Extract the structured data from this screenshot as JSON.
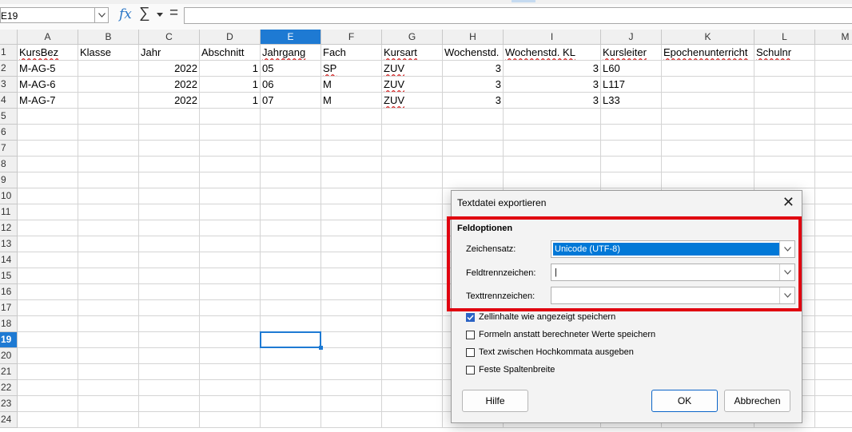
{
  "formula_bar": {
    "name_box": "E19",
    "fx_label": "fx",
    "sigma_label": "∑",
    "equals_label": "=",
    "formula": ""
  },
  "sheet": {
    "columns": [
      "A",
      "B",
      "C",
      "D",
      "E",
      "F",
      "G",
      "H",
      "I",
      "J",
      "K",
      "L",
      "M"
    ],
    "selected_column": "E",
    "rows": [
      "1",
      "2",
      "3",
      "4",
      "5",
      "6",
      "7",
      "8",
      "9",
      "10",
      "11",
      "12",
      "13",
      "14",
      "15",
      "16",
      "17",
      "18",
      "19",
      "20",
      "21",
      "22",
      "23",
      "24"
    ],
    "selected_row": "19",
    "header": [
      "KursBez",
      "Klasse",
      "Jahr",
      "Abschnitt",
      "Jahrgang",
      "Fach",
      "Kursart",
      "Wochenstd.",
      "Wochenstd. KL",
      "Kursleiter",
      "Epochenunterricht",
      "Schulnr"
    ],
    "data": [
      [
        "M-AG-5",
        "",
        "2022",
        "1",
        "05",
        "SP",
        "ZUV",
        "3",
        "3",
        "L60",
        "",
        ""
      ],
      [
        "M-AG-6",
        "",
        "2022",
        "1",
        "06",
        "M",
        "ZUV",
        "3",
        "3",
        "L117",
        "",
        ""
      ],
      [
        "M-AG-7",
        "",
        "2022",
        "1",
        "07",
        "M",
        "ZUV",
        "3",
        "3",
        "L33",
        "",
        ""
      ]
    ]
  },
  "dialog": {
    "title": "Textdatei exportieren",
    "close_glyph": "✕",
    "section_title": "Feldoptionen",
    "fields": [
      {
        "label": "Zeichensatz:",
        "value": "Unicode (UTF-8)"
      },
      {
        "label": "Feldtrennzeichen:",
        "value": "|"
      },
      {
        "label": "Texttrennzeichen:",
        "value": ""
      }
    ],
    "checkboxes": [
      {
        "label": "Zellinhalte wie angezeigt speichern",
        "checked": true
      },
      {
        "label": "Formeln anstatt berechneter Werte speichern",
        "checked": false
      },
      {
        "label": "Text zwischen Hochkommata ausgeben",
        "checked": false
      },
      {
        "label": "Feste Spaltenbreite",
        "checked": false
      }
    ],
    "buttons": {
      "help": "Hilfe",
      "ok": "OK",
      "cancel": "Abbrechen"
    }
  },
  "colors": {
    "accent": "#1e7ad3",
    "annotation": "#e0000f",
    "spellcheck": "#d42020"
  }
}
